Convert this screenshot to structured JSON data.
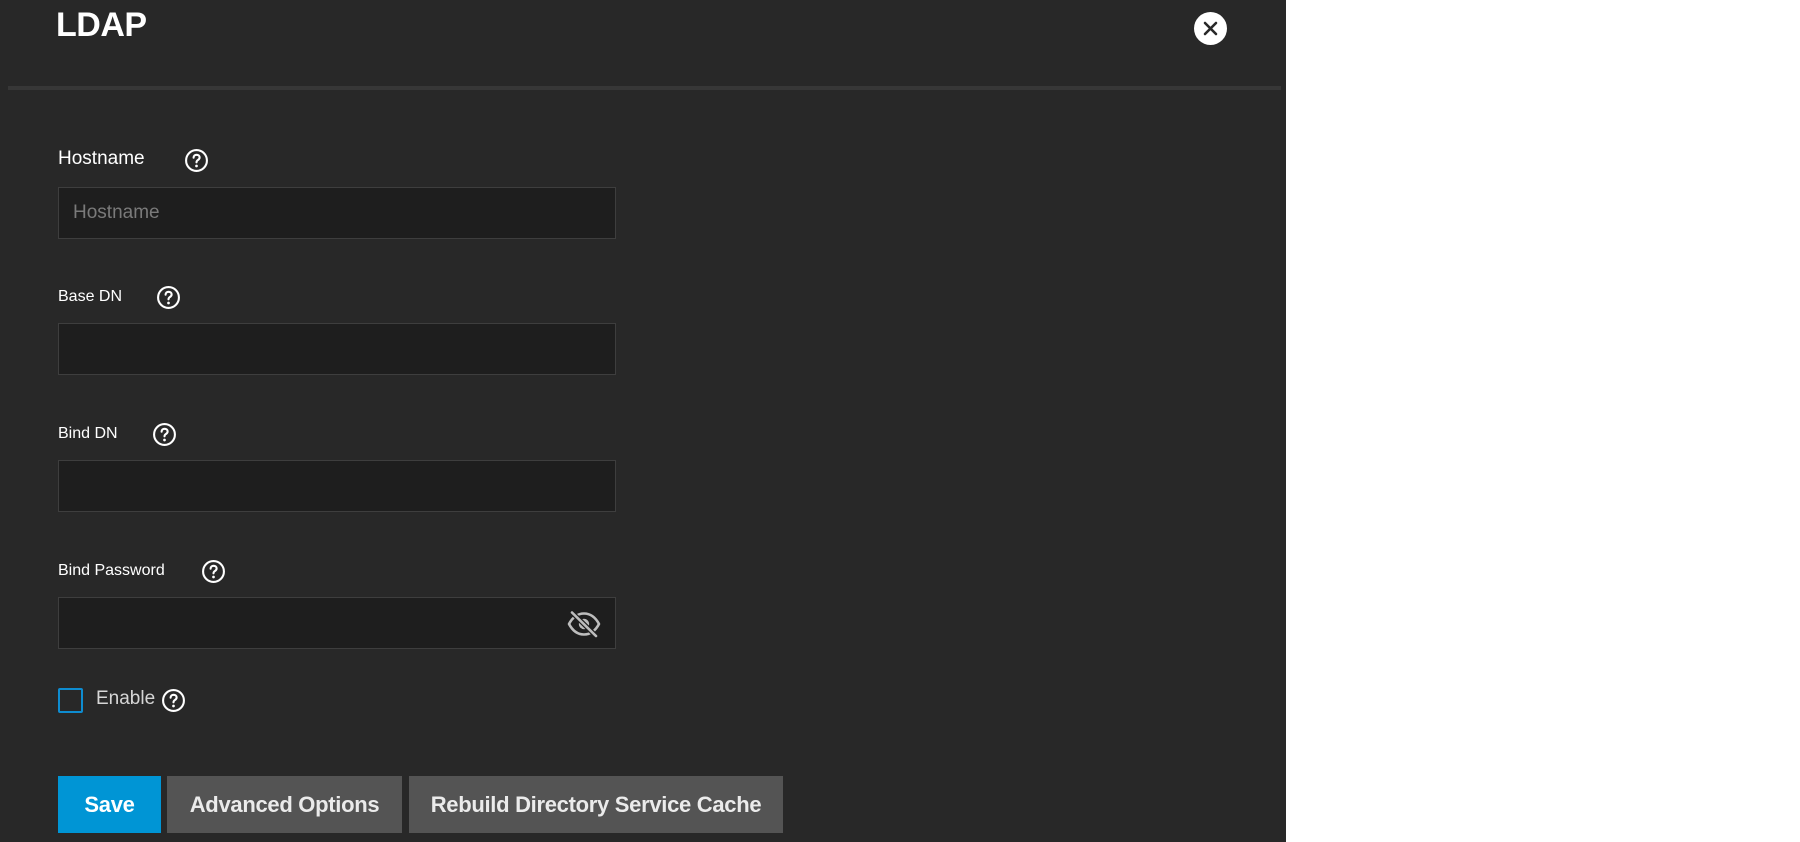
{
  "dialog": {
    "title": "LDAP"
  },
  "form": {
    "hostname": {
      "label": "Hostname",
      "placeholder": "Hostname",
      "value": ""
    },
    "base_dn": {
      "label": "Base DN",
      "value": ""
    },
    "bind_dn": {
      "label": "Bind DN",
      "value": ""
    },
    "bind_password": {
      "label": "Bind Password",
      "value": ""
    },
    "enable": {
      "label": "Enable",
      "checked": false
    }
  },
  "buttons": {
    "save": "Save",
    "advanced": "Advanced Options",
    "rebuild": "Rebuild Directory Service Cache"
  },
  "icons": {
    "close": "close-icon",
    "help": "help-circle-icon",
    "password_visibility": "eye-off-icon"
  },
  "colors": {
    "panel_bg": "#282828",
    "input_bg": "#1e1e1e",
    "primary": "#0095d5",
    "secondary_button": "#545454",
    "checkbox_border": "#0e8cd0"
  }
}
